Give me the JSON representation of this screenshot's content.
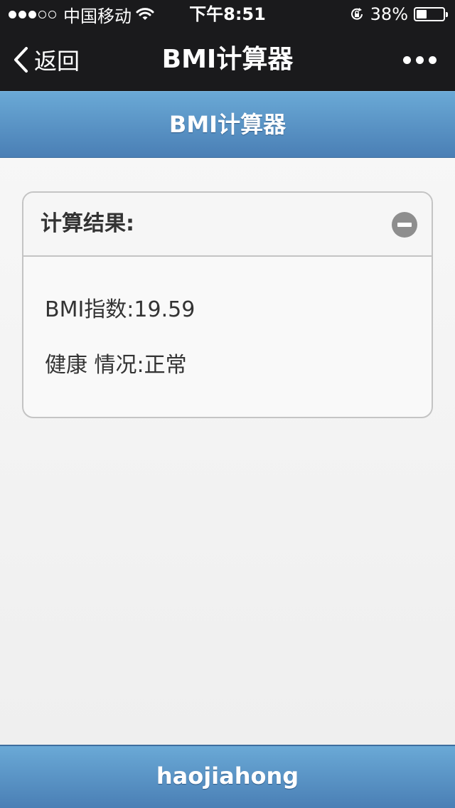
{
  "status_bar": {
    "carrier": "中国移动",
    "time": "下午8:51",
    "battery": "38%",
    "battery_level": 0.38,
    "icons": [
      "signal-dots",
      "wifi-icon",
      "rotation-lock-icon",
      "battery-icon"
    ]
  },
  "nav": {
    "back_label": "返回",
    "title": "BMI计算器",
    "icons": [
      "chevron-left-icon",
      "more-icon"
    ]
  },
  "page": {
    "header_title": "BMI计算器",
    "footer_text": "haojiahong"
  },
  "result_card": {
    "title": "计算结果:",
    "icon": "minus-circle-icon",
    "bmi_label": "BMI指数:",
    "bmi_value": "19.59",
    "health_label": "健康 情况:",
    "health_value": "正常"
  },
  "colors": {
    "header_gradient_top": "#6aa9d6",
    "header_gradient_bottom": "#4a7fb5",
    "nav_background": "#1a1a1c",
    "page_background": "#f4f4f4"
  }
}
